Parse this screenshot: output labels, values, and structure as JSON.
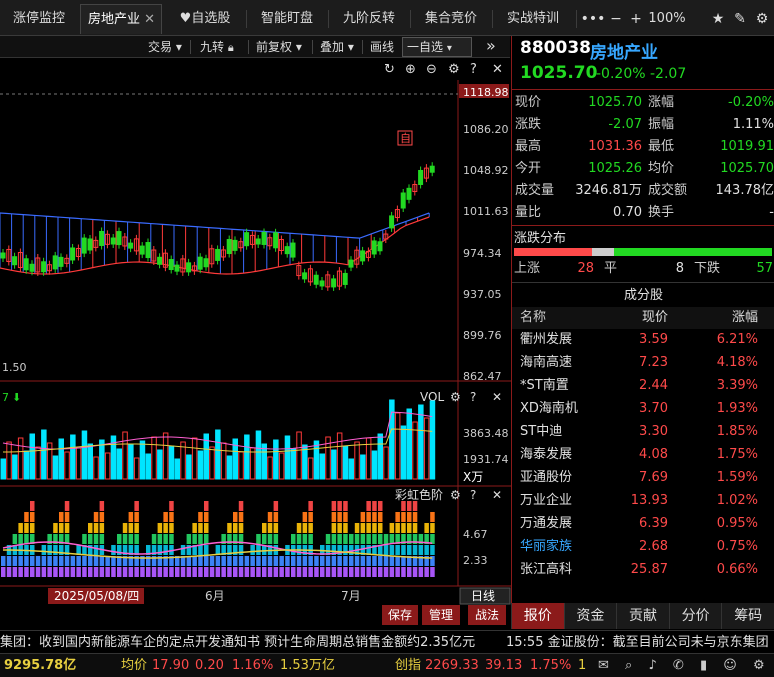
{
  "tabs": [
    {
      "label": "涨停监控",
      "active": false
    },
    {
      "label": "房地产业",
      "active": true,
      "closable": true
    },
    {
      "label": "自选股",
      "icon": "heart-icon"
    },
    {
      "label": "智能盯盘"
    },
    {
      "label": "九阶反转"
    },
    {
      "label": "集合竞价"
    },
    {
      "label": "实战特训"
    }
  ],
  "toolbar_right": {
    "more": "•••",
    "zoom": "100%"
  },
  "chart_toolbar": {
    "trade": "交易 ▾",
    "jiuzhuan": "九转",
    "fq": "前复权 ▾",
    "overlay": "叠加 ▾",
    "draw": "画线",
    "watchlist": "一自选",
    "expand": "»"
  },
  "price_axis": [
    "1118.98",
    "1086.20",
    "1048.92",
    "1011.63",
    "974.34",
    "937.05",
    "899.76",
    "862.47"
  ],
  "left_low_label": "1.50",
  "vol_panel": {
    "title": "VOL",
    "axis": [
      "3863.48",
      "1931.74"
    ],
    "unit": "X万",
    "left_label": "7"
  },
  "rainbow_panel": {
    "title": "彩虹色阶",
    "axis": [
      "4.67",
      "2.33"
    ]
  },
  "date_axis": {
    "selected": "2025/05/08/四",
    "labels": [
      "6月",
      "7月"
    ],
    "period_btn": "日线"
  },
  "chart_buttons": [
    "保存",
    "管理",
    "战法"
  ],
  "marker_label": "自",
  "stock": {
    "code": "880038",
    "name": "房地产业",
    "price": "1025.70",
    "change_pct": "-0.20%",
    "change": "-2.07"
  },
  "quote": [
    {
      "l1": "现价",
      "v1": "1025.70",
      "c1": "green",
      "l2": "涨幅",
      "v2": "-0.20%",
      "c2": "green"
    },
    {
      "l1": "涨跌",
      "v1": "-2.07",
      "c1": "green",
      "l2": "振幅",
      "v2": "1.11%",
      "c2": "white"
    },
    {
      "l1": "最高",
      "v1": "1031.36",
      "c1": "red",
      "l2": "最低",
      "v2": "1019.91",
      "c2": "green"
    },
    {
      "l1": "今开",
      "v1": "1025.26",
      "c1": "green",
      "l2": "均价",
      "v2": "1025.70",
      "c2": "green"
    },
    {
      "l1": "成交量",
      "v1": "3246.81万",
      "c1": "white",
      "l2": "成交额",
      "v2": "143.78亿",
      "c2": "white"
    },
    {
      "l1": "量比",
      "v1": "0.70",
      "c1": "white",
      "l2": "换手",
      "v2": "-",
      "c2": "white"
    }
  ],
  "distribution": {
    "title": "涨跌分布",
    "up_label": "上涨",
    "up": "28",
    "flat_label": "平",
    "flat": "8",
    "down_label": "下跌",
    "down": "57",
    "up_ratio": 0.301,
    "flat_ratio": 0.086
  },
  "components": {
    "title": "成分股",
    "headers": [
      "名称",
      "现价",
      "涨幅"
    ],
    "rows": [
      {
        "name": "衢州发展",
        "price": "3.59",
        "pct": "6.21%"
      },
      {
        "name": "海南高速",
        "price": "7.23",
        "pct": "4.18%"
      },
      {
        "name": "*ST南置",
        "price": "2.44",
        "pct": "3.39%"
      },
      {
        "name": "XD海南机",
        "price": "3.70",
        "pct": "1.93%"
      },
      {
        "name": "ST中迪",
        "price": "3.30",
        "pct": "1.85%"
      },
      {
        "name": "海泰发展",
        "price": "4.08",
        "pct": "1.75%"
      },
      {
        "name": "亚通股份",
        "price": "7.69",
        "pct": "1.59%"
      },
      {
        "name": "万业企业",
        "price": "13.93",
        "pct": "1.02%"
      },
      {
        "name": "万通发展",
        "price": "6.39",
        "pct": "0.95%"
      },
      {
        "name": "华丽家族",
        "price": "2.68",
        "pct": "0.75%",
        "highlight": true
      },
      {
        "name": "张江高科",
        "price": "25.87",
        "pct": "0.66%"
      }
    ]
  },
  "right_nav": [
    "报价",
    "资金",
    "贡献",
    "分价",
    "筹码"
  ],
  "news": {
    "left": "集团：收到国内新能源车企的定点开发通知书 预计生命周期总销售金额约2.35亿元",
    "right": "15:55 金证股份：截至目前公司未与京东集团"
  },
  "status": {
    "amount": "9295.78亿",
    "avg_label": "均价",
    "avg": "17.90",
    "avg_chg": "0.20",
    "avg_pct": "1.16%",
    "avg_amt": "1.53万亿",
    "cy_label": "创指",
    "cy": "2269.33",
    "cy_chg": "39.13",
    "cy_pct": "1.75%",
    "cy_amt": "1"
  },
  "colors": {
    "accent": "#8b1a1a",
    "up": "#ff4a4a",
    "down": "#22d922",
    "cyan_bar": "#00e5ff",
    "blue_band": "#3a6bff"
  }
}
